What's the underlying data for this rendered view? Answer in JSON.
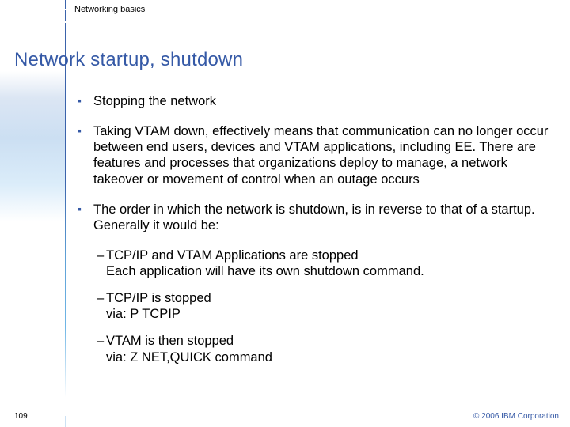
{
  "header": {
    "label": "Networking basics"
  },
  "title": "Network startup, shutdown",
  "bullets": [
    {
      "text": "Stopping the network"
    },
    {
      "text": "Taking VTAM down, effectively means that communication can no longer occur between end users, devices and VTAM applications, including EE. There are features and processes that organizations deploy to manage, a network takeover or movement of control when an outage occurs"
    },
    {
      "text": "The order in which the network is shutdown, is in reverse to that of a startup. Generally it would be:"
    }
  ],
  "subs": [
    {
      "line1": "TCP/IP and VTAM Applications are stopped",
      "line2": "Each application will have its own shutdown command."
    },
    {
      "line1": "TCP/IP is stopped",
      "line2": "via: P TCPIP"
    },
    {
      "line1": "VTAM is then stopped",
      "line2": "via: Z NET,QUICK command"
    }
  ],
  "footer": {
    "page": "109",
    "copyright": "© 2006 IBM Corporation"
  }
}
